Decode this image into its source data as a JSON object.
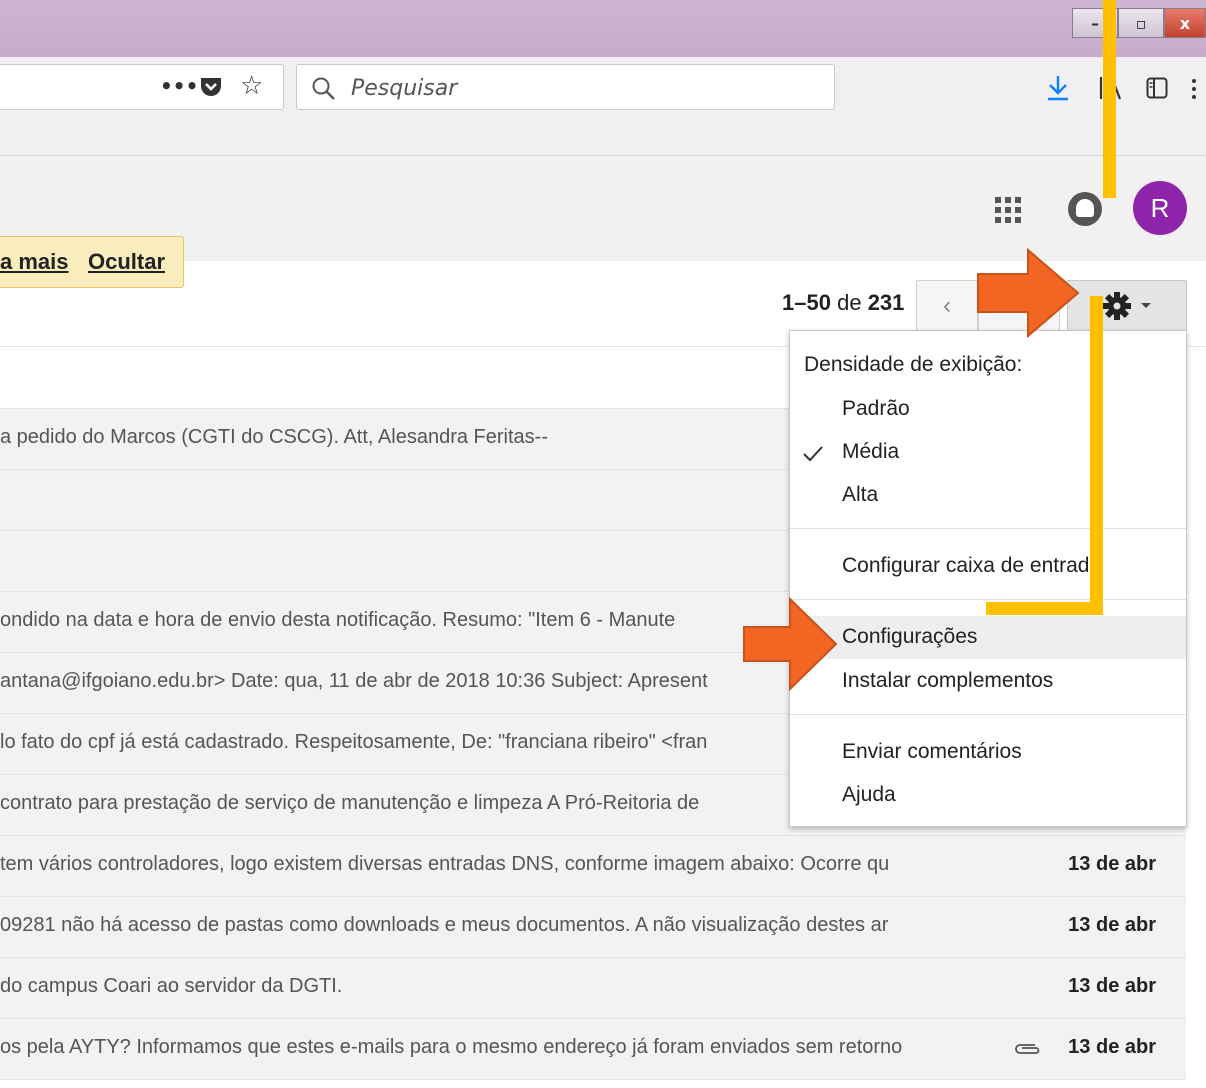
{
  "browser": {
    "window_buttons": [
      "–",
      "▫",
      "x"
    ],
    "url_icons": {
      "more": "•••",
      "pocket": "pocket-icon",
      "bookmark": "☆"
    },
    "search": {
      "placeholder": "Pesquisar",
      "value": ""
    },
    "toolbar_icons": [
      "download-icon",
      "library-icon",
      "sidebar-icon",
      "menu-icon"
    ]
  },
  "gmail": {
    "avatar_letter": "R",
    "notice": {
      "more_label": "a mais",
      "hide_label": "Ocultar"
    },
    "pager": {
      "range": "1–50",
      "of": "de",
      "total": "231"
    },
    "nav_prev": "‹",
    "gear": "✲",
    "rows": [
      {
        "snippet": "",
        "date": ""
      },
      {
        "snippet": "a pedido do Marcos (CGTI do CSCG). Att, Alesandra Feritas--",
        "date": ""
      },
      {
        "snippet": "",
        "date": ""
      },
      {
        "snippet": "",
        "date": ""
      },
      {
        "snippet": "ondido na data e hora de envio desta notificação. Resumo: \"Item 6 - Manute",
        "date": ""
      },
      {
        "snippet": "antana@ifgoiano.edu.br> Date: qua, 11 de abr de 2018 10:36 Subject: Apresent",
        "date": ""
      },
      {
        "snippet": "lo fato do cpf já está cadastrado. Respeitosamente, De: \"franciana ribeiro\" <fran",
        "date": ""
      },
      {
        "snippet": "contrato para prestação de serviço de manutenção e limpeza A Pró-Reitoria de",
        "date": ""
      },
      {
        "snippet": "tem vários controladores, logo existem diversas entradas DNS, conforme imagem abaixo: Ocorre qu",
        "date": "13 de abr"
      },
      {
        "snippet": "09281 não há acesso de pastas como downloads e meus documentos. A não visualização destes ar",
        "date": "13 de abr"
      },
      {
        "snippet": "do campus Coari ao servidor da DGTI.",
        "date": "13 de abr"
      },
      {
        "snippet": "os pela AYTY? Informamos que estes e-mails para o mesmo endereço já foram enviados sem retorno",
        "date": "13 de abr",
        "attachment": true
      }
    ],
    "menu": {
      "density_heading": "Densidade de exibição:",
      "density_options": [
        "Padrão",
        "Média",
        "Alta"
      ],
      "selected_density": "Média",
      "configure_inbox": "Configurar caixa de entrada",
      "settings": "Configurações",
      "install_addons": "Instalar complementos",
      "send_feedback": "Enviar comentários",
      "help": "Ajuda"
    }
  },
  "annotations": {
    "arrow_color": "#f26522",
    "line_color": "#ffc000"
  }
}
